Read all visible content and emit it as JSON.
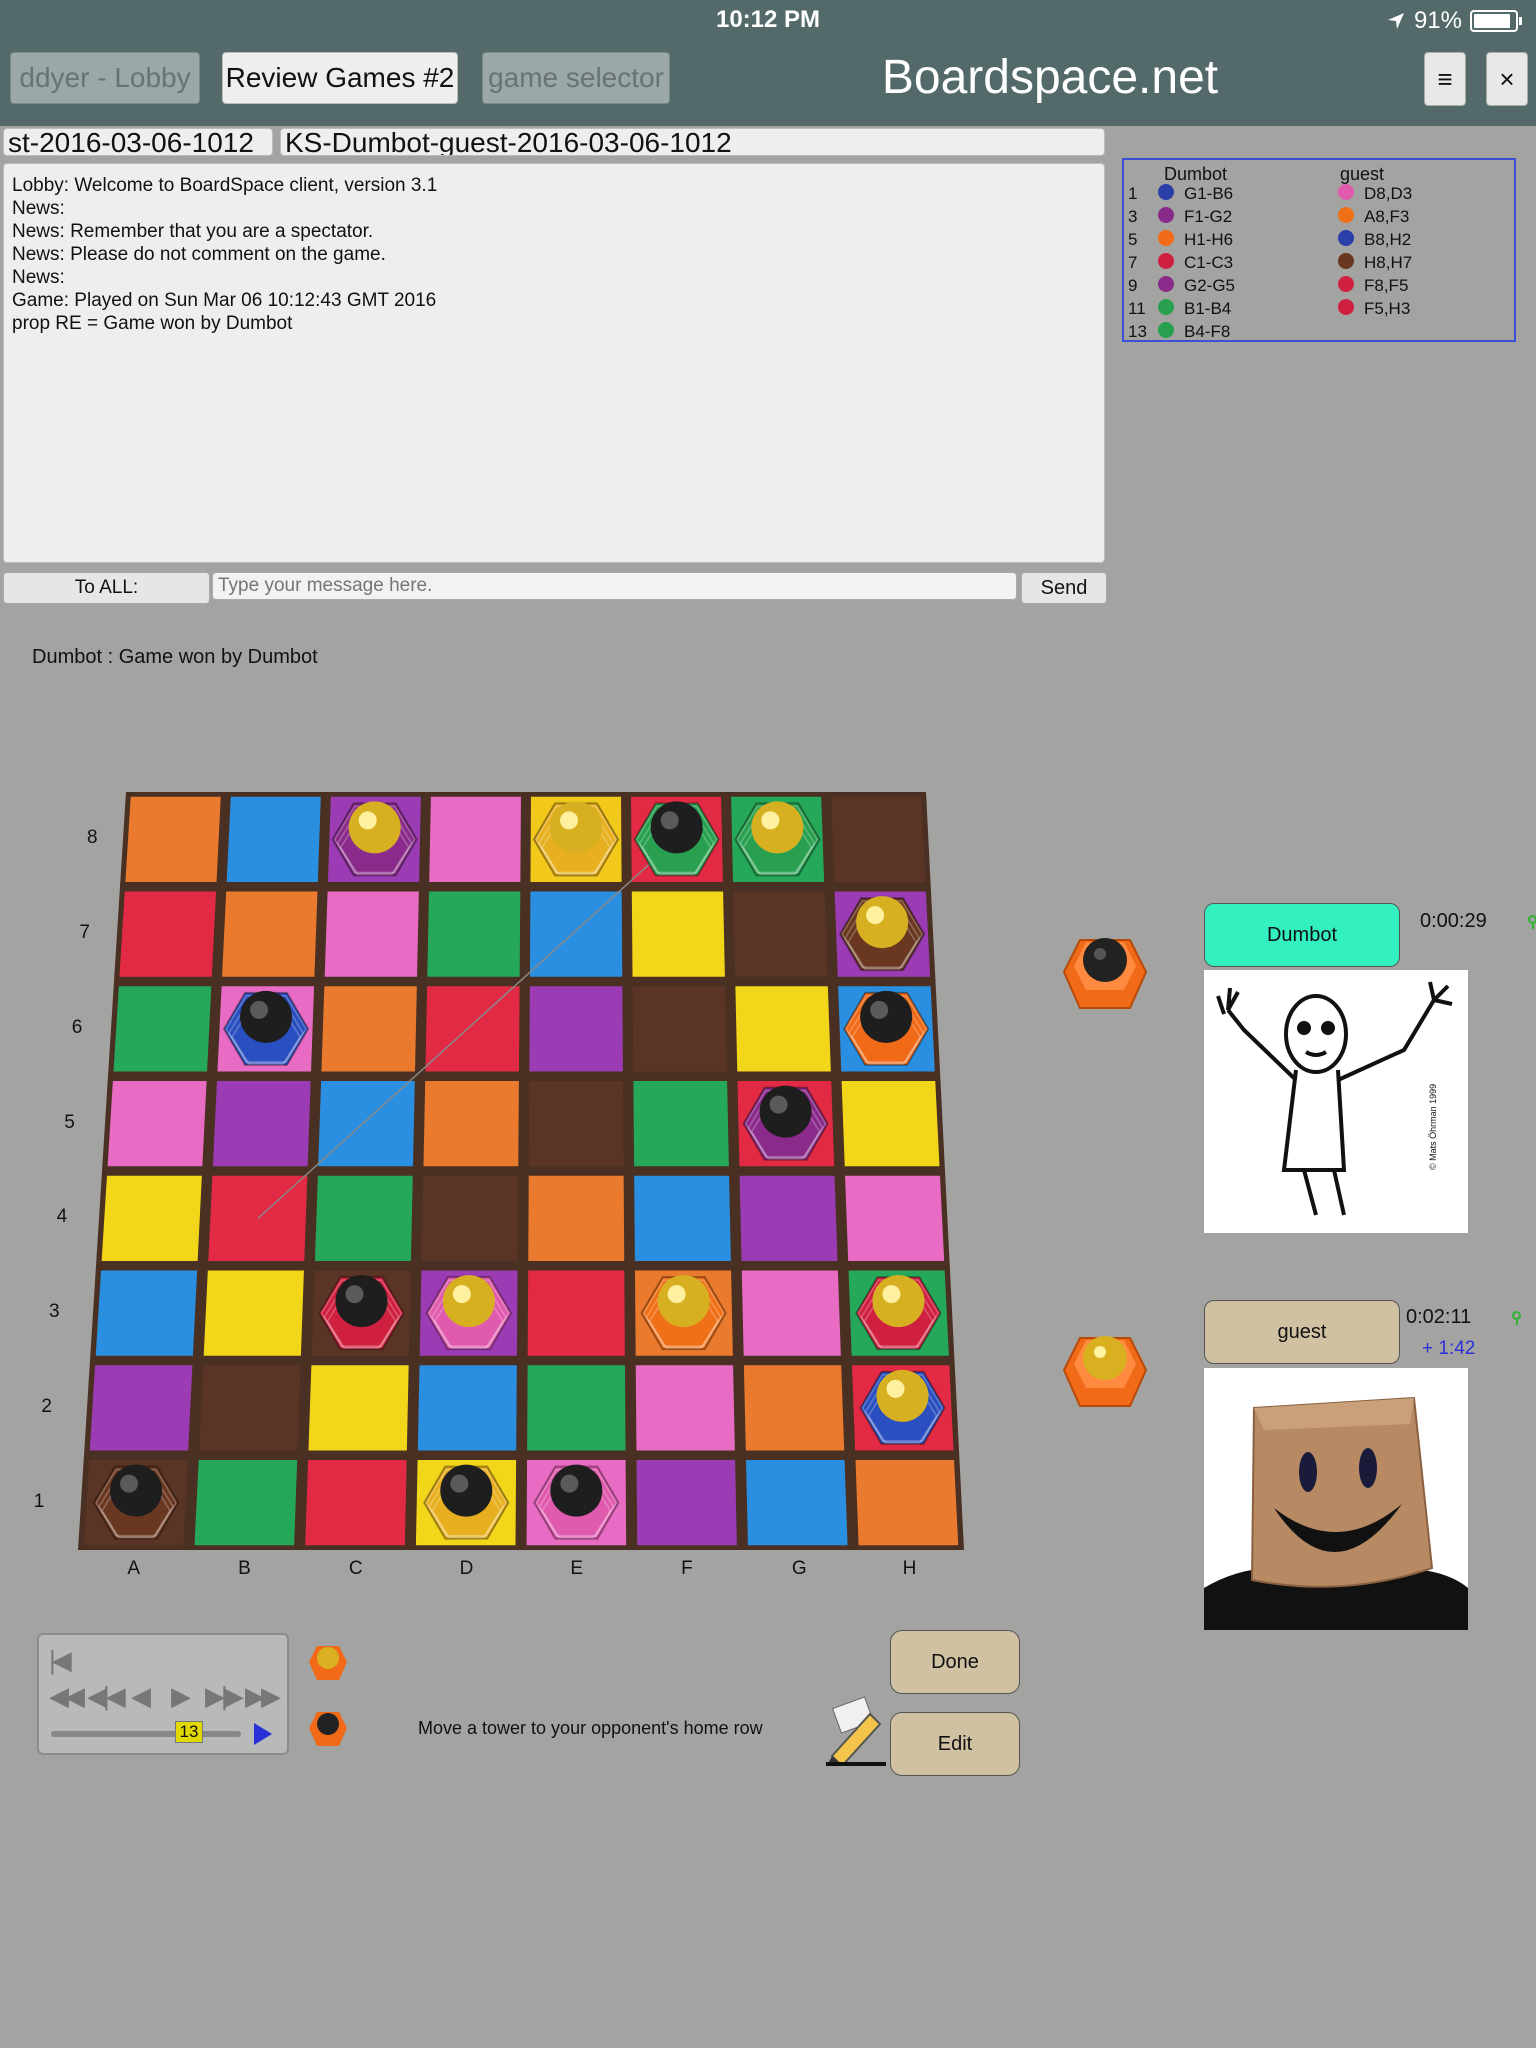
{
  "status_bar": {
    "time": "10:12 PM",
    "battery": "91%"
  },
  "header": {
    "lobby_button": "ddyer - Lobby",
    "review_button": "Review Games #2",
    "selector_button": "game selector",
    "site_title": "Boardspace.net",
    "menu_icon": "≡",
    "close_icon": "×"
  },
  "tabs": [
    "st-2016-03-06-1012",
    "KS-Dumbot-guest-2016-03-06-1012"
  ],
  "chat": {
    "lines": [
      "Lobby: Welcome to BoardSpace client, version 3.1",
      "News:",
      "News: Remember that you are a spectator.",
      "News: Please do not comment on the game.",
      "News:",
      "Game: Played on Sun Mar 06 10:12:43 GMT 2016",
      "prop RE = Game won by Dumbot"
    ],
    "to_all": "To ALL:",
    "placeholder": "Type your message here.",
    "send": "Send"
  },
  "move_log": {
    "player1": "Dumbot",
    "player2": "guest",
    "rows": [
      {
        "num": "1",
        "p1": "G1-B6",
        "p2": "D8,D3",
        "c1": "#2a3fa8",
        "c2": "#e05aae"
      },
      {
        "num": "3",
        "p1": "F1-G2",
        "p2": "A8,F3",
        "c1": "#8a2a8a",
        "c2": "#f07018"
      },
      {
        "num": "5",
        "p1": "H1-H6",
        "p2": "B8,H2",
        "c1": "#f06a18",
        "c2": "#2a3fa8"
      },
      {
        "num": "7",
        "p1": "C1-C3",
        "p2": "H8,H7",
        "c1": "#d02040",
        "c2": "#6a3820"
      },
      {
        "num": "9",
        "p1": "G2-G5",
        "p2": "F8,F5",
        "c1": "#8a2a8a",
        "c2": "#d02040"
      },
      {
        "num": "11",
        "p1": "B1-B4",
        "p2": "F5,H3",
        "c1": "#28a050",
        "c2": "#d02040"
      },
      {
        "num": "13",
        "p1": "B4-F8",
        "p2": "",
        "c1": "#28a050",
        "c2": ""
      }
    ]
  },
  "game_status": "Dumbot : Game won by Dumbot",
  "board": {
    "ranks": [
      "8",
      "7",
      "6",
      "5",
      "4",
      "3",
      "2",
      "1"
    ],
    "files": [
      "A",
      "B",
      "C",
      "D",
      "E",
      "F",
      "G",
      "H"
    ],
    "cells": [
      [
        "#ea7a2e",
        "#2a8fe0",
        "#9c3cb4",
        "#e86cc4",
        "#f2c81a",
        "#e22a44",
        "#25a85a",
        "#5a3424"
      ],
      [
        "#e22a44",
        "#ea7a2e",
        "#e86cc4",
        "#25a85a",
        "#2a8fe0",
        "#f2d61a",
        "#5a3424",
        "#9c3cb4"
      ],
      [
        "#25a85a",
        "#e86cc4",
        "#ea7a2e",
        "#e22a44",
        "#9c3cb4",
        "#5a3424",
        "#f2d61a",
        "#2a8fe0"
      ],
      [
        "#e86cc4",
        "#9c3cb4",
        "#2a8fe0",
        "#ea7a2e",
        "#5a3424",
        "#25a85a",
        "#e22a44",
        "#f2d61a"
      ],
      [
        "#f2d61a",
        "#e22a44",
        "#25a85a",
        "#5a3424",
        "#ea7a2e",
        "#2a8fe0",
        "#9c3cb4",
        "#e86cc4"
      ],
      [
        "#2a8fe0",
        "#f2d61a",
        "#5a3424",
        "#9c3cb4",
        "#e22a44",
        "#ea7a2e",
        "#e86cc4",
        "#25a85a"
      ],
      [
        "#9c3cb4",
        "#5a3424",
        "#f2d61a",
        "#2a8fe0",
        "#25a85a",
        "#e86cc4",
        "#ea7a2e",
        "#e22a44"
      ],
      [
        "#5a3424",
        "#25a85a",
        "#e22a44",
        "#f2d61a",
        "#e86cc4",
        "#9c3cb4",
        "#2a8fe0",
        "#ea7a2e"
      ]
    ],
    "pieces": [
      {
        "square": "C8",
        "color": "#8a2a8a",
        "top": "gold"
      },
      {
        "square": "E8",
        "color": "#e8b020",
        "top": "gold"
      },
      {
        "square": "F8",
        "color": "#28a050",
        "top": "black"
      },
      {
        "square": "G8",
        "color": "#28a050",
        "top": "gold"
      },
      {
        "square": "H7",
        "color": "#6a3820",
        "top": "gold"
      },
      {
        "square": "B6",
        "color": "#2a4fc0",
        "top": "black"
      },
      {
        "square": "H6",
        "color": "#f06a18",
        "top": "black"
      },
      {
        "square": "G5",
        "color": "#8a2a8a",
        "top": "black"
      },
      {
        "square": "C3",
        "color": "#d02040",
        "top": "black"
      },
      {
        "square": "D3",
        "color": "#e05aae",
        "top": "gold"
      },
      {
        "square": "F3",
        "color": "#f07018",
        "top": "gold"
      },
      {
        "square": "H3",
        "color": "#d02040",
        "top": "gold"
      },
      {
        "square": "H2",
        "color": "#2a4fc0",
        "top": "gold"
      },
      {
        "square": "A1",
        "color": "#6a3820",
        "top": "black"
      },
      {
        "square": "D1",
        "color": "#e8b020",
        "top": "black"
      },
      {
        "square": "E1",
        "color": "#e05aae",
        "top": "black"
      }
    ]
  },
  "players": {
    "p1": {
      "name": "Dumbot",
      "time": "0:00:29",
      "color": "#33f0c0"
    },
    "p2": {
      "name": "guest",
      "time": "0:02:11",
      "extra": "+ 1:42",
      "color": "#d0c1a3"
    }
  },
  "portrait_credit": "© Mats Öhrman 1999",
  "controls": {
    "move_number": "13"
  },
  "hint": "Move a tower to your opponent's home row",
  "buttons": {
    "done": "Done",
    "edit": "Edit"
  },
  "icons": {
    "menu": "menu-icon",
    "close": "close-icon",
    "edit": "pencil-icon",
    "location": "location-arrow-icon",
    "battery": "battery-icon"
  }
}
